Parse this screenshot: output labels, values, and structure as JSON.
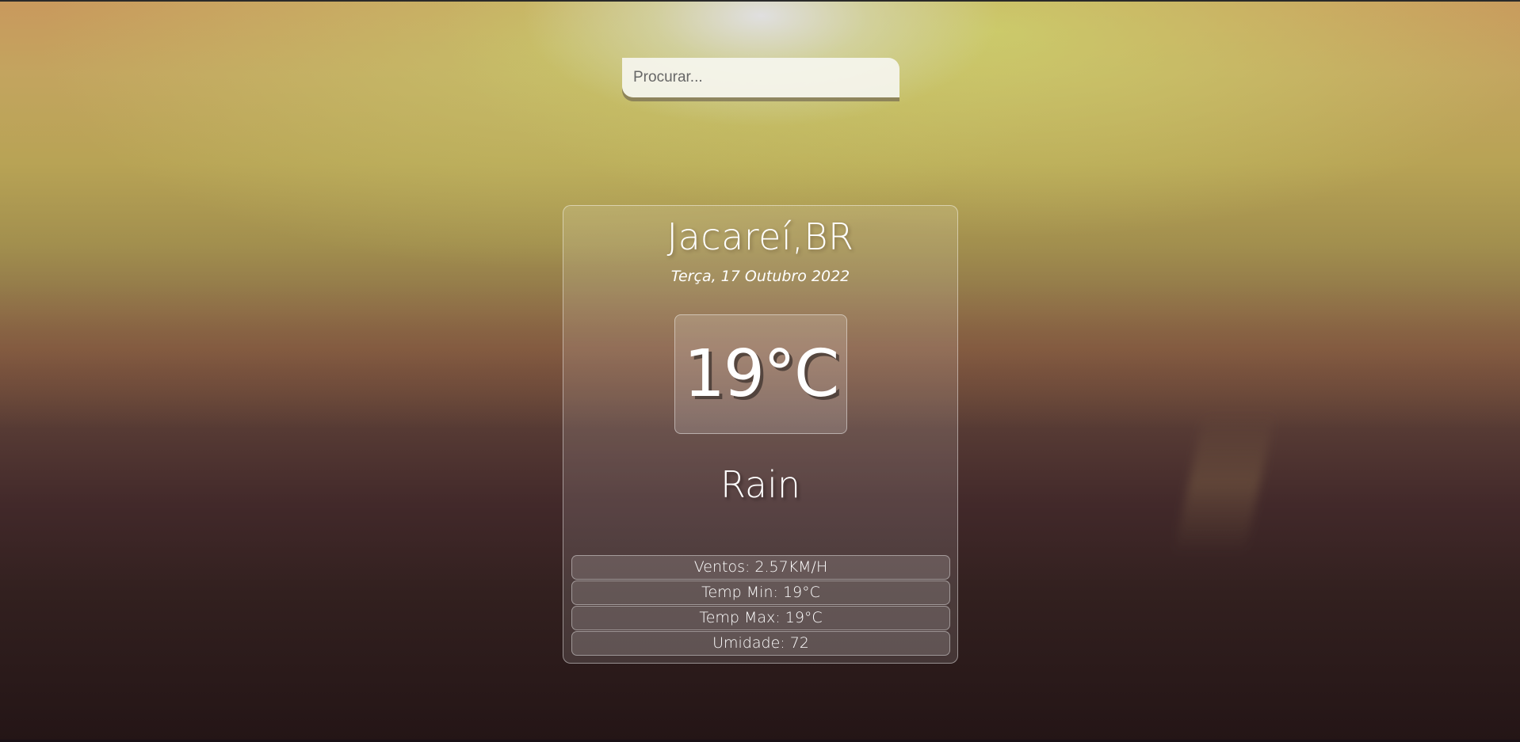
{
  "search": {
    "placeholder": "Procurar..."
  },
  "weather": {
    "location": "Jacareí,BR",
    "date": "Terça, 17 Outubro 2022",
    "temperature": "19°C",
    "condition": "Rain",
    "details": [
      "Ventos: 2.57KM/H",
      "Temp Min: 19°C",
      "Temp Max: 19°C",
      "Umidade: 72"
    ]
  },
  "icons": {
    "background": "sunset-sea-background"
  }
}
